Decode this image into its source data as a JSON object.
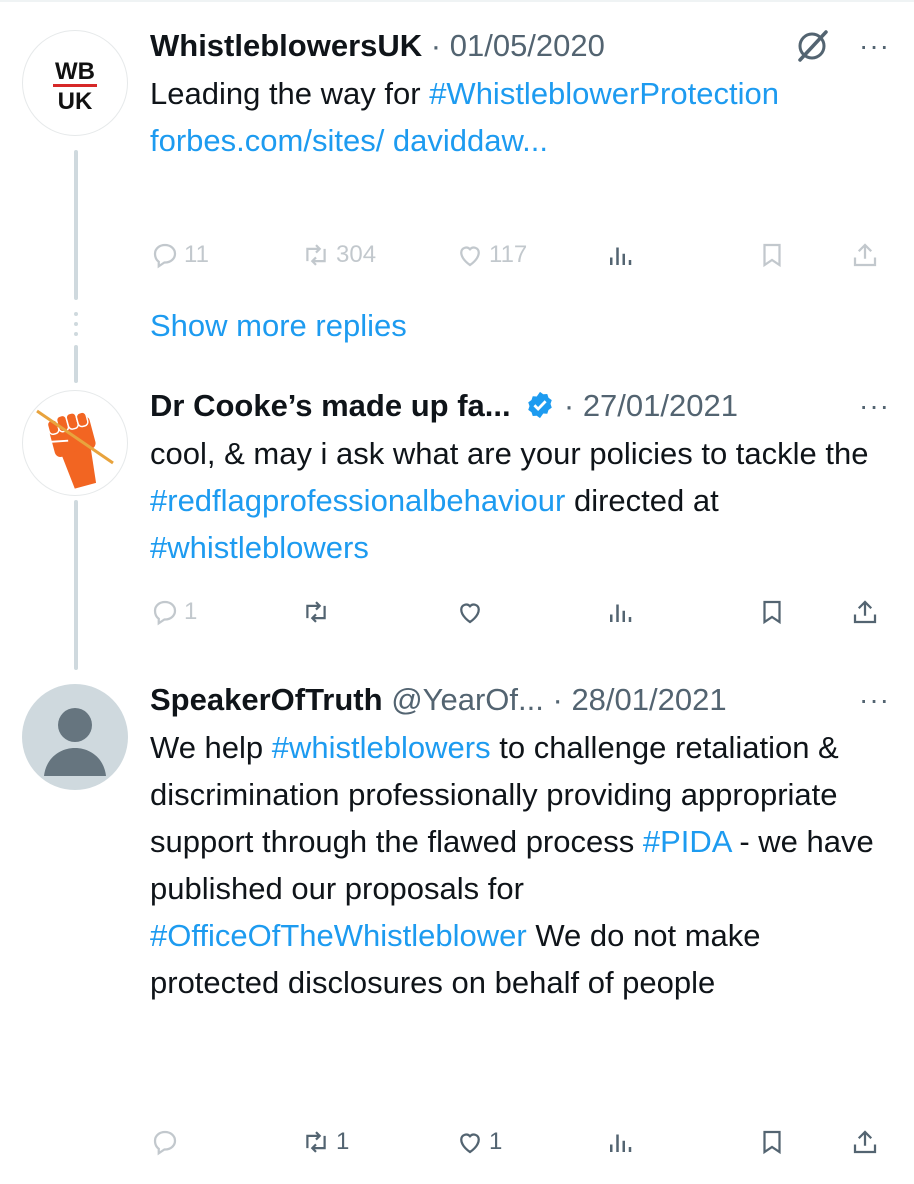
{
  "colors": {
    "link": "#1d9bf0",
    "text": "#0f1419",
    "secondary": "#536471",
    "thread_line": "#cfd9de",
    "verified": "#1d9bf0",
    "fist": "#f26522"
  },
  "tweets": [
    {
      "avatar": {
        "kind": "logo",
        "line1": "WB",
        "line2": "UK"
      },
      "name": "WhistleblowersUK",
      "dot": "·",
      "date": "01/05/2020",
      "more": "···",
      "body": [
        {
          "t": "text",
          "v": "Leading the way for "
        },
        {
          "t": "tag",
          "v": "#WhistleblowerProtection"
        },
        {
          "t": "text",
          "v": " "
        },
        {
          "t": "tag",
          "v": "forbes.com/sites/ daviddaw..."
        }
      ],
      "actions": {
        "replies": "11",
        "reposts": "304",
        "likes": "117"
      }
    },
    {
      "avatar": {
        "kind": "fist-icon"
      },
      "name": "Dr Cooke’s made up fa...",
      "verified": true,
      "dot": "·",
      "date": "27/01/2021",
      "more": "···",
      "body": [
        {
          "t": "text",
          "v": "cool, & may i ask what are your policies to tackle the "
        },
        {
          "t": "tag",
          "v": "#redflagprofessionalbehaviour"
        },
        {
          "t": "text",
          "v": " directed at "
        },
        {
          "t": "tag",
          "v": "#whistleblowers"
        }
      ],
      "actions": {
        "replies": "1",
        "reposts": "",
        "likes": ""
      }
    },
    {
      "avatar": {
        "kind": "default-person-icon"
      },
      "name": "SpeakerOfTruth",
      "handle": "@YearOf...",
      "dot": "·",
      "date": "28/01/2021",
      "more": "···",
      "body": [
        {
          "t": "text",
          "v": "We help "
        },
        {
          "t": "tag",
          "v": "#whistleblowers"
        },
        {
          "t": "text",
          "v": " to challenge retaliation & discrimination professionally providing appropriate support through the flawed process "
        },
        {
          "t": "tag",
          "v": "#PIDA"
        },
        {
          "t": "text",
          "v": " - we have published our proposals for "
        },
        {
          "t": "tag",
          "v": "#OfficeOfTheWhistleblower"
        },
        {
          "t": "text",
          "v": " We do not make protected disclosures on behalf of people"
        }
      ],
      "actions": {
        "replies": "",
        "reposts": "1",
        "likes": "1"
      }
    }
  ],
  "show_more_replies": "Show more replies"
}
